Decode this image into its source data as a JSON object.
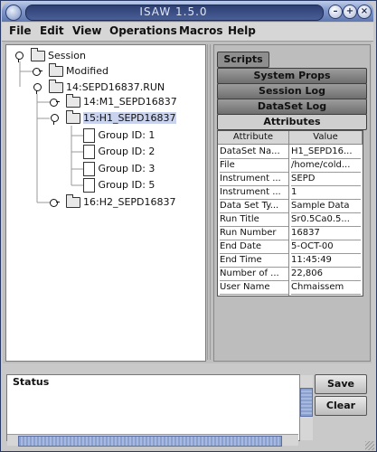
{
  "window": {
    "title": "ISAW 1.5.0"
  },
  "menubar": {
    "items": [
      "File",
      "Edit",
      "View",
      "Operations",
      "Macros",
      "Help"
    ]
  },
  "tree": {
    "session": "Session",
    "modified": "Modified",
    "run": "14:SEPD16837.RUN",
    "nodes": [
      "14:M1_SEPD16837",
      "15:H1_SEPD16837",
      "16:H2_SEPD16837"
    ],
    "groups": [
      "Group ID: 1",
      "Group ID: 2",
      "Group ID: 3",
      "Group ID: 5"
    ]
  },
  "tabs": [
    "Scripts",
    "System Props",
    "Session Log",
    "DataSet Log",
    "Attributes"
  ],
  "attributes_table": {
    "headers": [
      "Attribute",
      "Value"
    ],
    "rows": [
      [
        "DataSet Na...",
        "H1_SEPD16..."
      ],
      [
        "File",
        "/home/cold..."
      ],
      [
        "Instrument ...",
        "SEPD"
      ],
      [
        "Instrument ...",
        "1"
      ],
      [
        "Data Set Ty...",
        "Sample Data"
      ],
      [
        "Run Title",
        "Sr0.5Ca0.5..."
      ],
      [
        "Run Number",
        "16837"
      ],
      [
        "End Date",
        " 5-OCT-00"
      ],
      [
        "End Time",
        "11:45:49"
      ],
      [
        "Number of ...",
        "22,806"
      ],
      [
        "User Name",
        "Chmaissem"
      ]
    ]
  },
  "status": {
    "label": "Status"
  },
  "buttons": {
    "save": "Save",
    "clear": "Clear"
  }
}
